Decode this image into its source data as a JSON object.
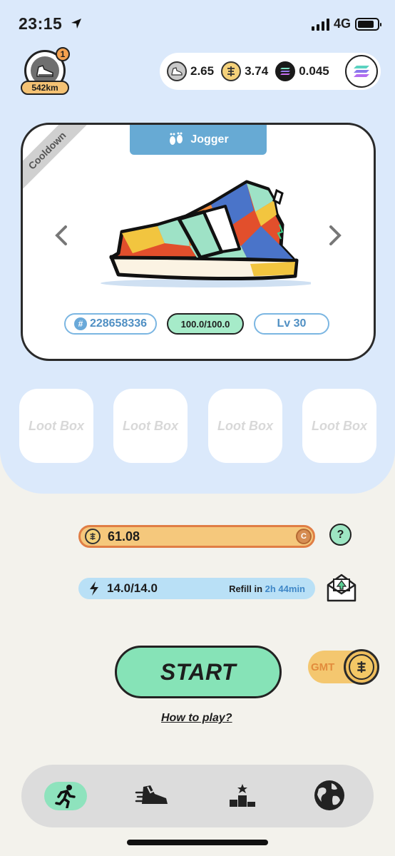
{
  "status_bar": {
    "time": "23:15",
    "network": "4G"
  },
  "profile": {
    "notification_count": "1",
    "distance": "542km"
  },
  "balances": [
    {
      "name": "gmt-token",
      "value": "2.65"
    },
    {
      "name": "gst-token",
      "value": "3.74"
    },
    {
      "name": "sol-token",
      "value": "0.045"
    }
  ],
  "sneaker": {
    "type": "Jogger",
    "status_ribbon": "Cooldown",
    "id": "228658336",
    "durability": "100.0/100.0",
    "level": "Lv 30"
  },
  "loot_boxes": [
    {
      "label": "Loot Box"
    },
    {
      "label": "Loot Box"
    },
    {
      "label": "Loot Box"
    },
    {
      "label": "Loot Box"
    }
  ],
  "gst_earnings": {
    "value": "61.08",
    "cap_icon": "C",
    "fill_fraction": 1.0
  },
  "help_label": "?",
  "energy": {
    "value": "14.0/14.0",
    "refill_label": "Refill in",
    "refill_time": "2h 44min"
  },
  "start_label": "START",
  "gmt_toggle_label": "GMT",
  "how_to_play": "How to play?",
  "nav": [
    "run-icon",
    "sneaker-icon",
    "podium-icon",
    "globe-icon"
  ],
  "colors": {
    "panel": "#dbe9fb",
    "accent_green": "#86e3b7",
    "gst_orange": "#e07e45",
    "energy_blue": "#b9e0f6"
  }
}
